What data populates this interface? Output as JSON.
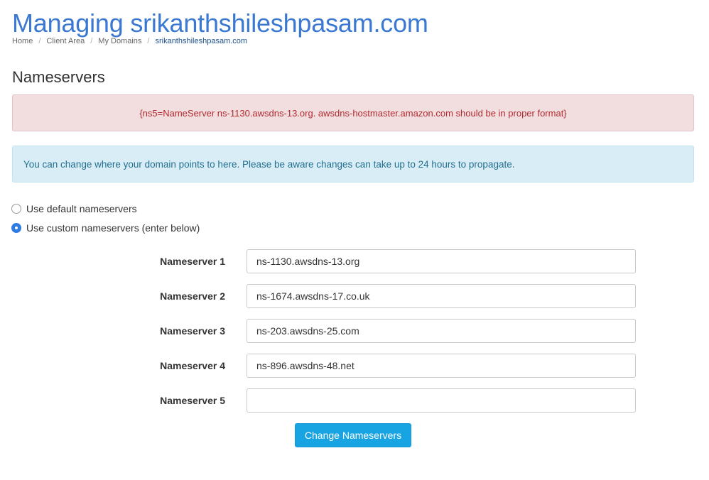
{
  "header": {
    "title": "Managing srikanthshileshpasam.com",
    "breadcrumb": [
      {
        "label": "Home"
      },
      {
        "label": "Client Area"
      },
      {
        "label": "My Domains"
      },
      {
        "label": "srikanthshileshpasam.com"
      }
    ],
    "breadcrumb_separator": "/"
  },
  "section": {
    "title": "Nameservers"
  },
  "alerts": {
    "error": "{ns5=NameServer ns-1130.awsdns-13.org. awsdns-hostmaster.amazon.com should be in proper format}",
    "info": "You can change where your domain points to here. Please be aware changes can take up to 24 hours to propagate."
  },
  "options": {
    "default_label": "Use default nameservers",
    "custom_label": "Use custom nameservers (enter below)",
    "selected": "custom"
  },
  "nameservers": [
    {
      "label": "Nameserver 1",
      "value": "ns-1130.awsdns-13.org"
    },
    {
      "label": "Nameserver 2",
      "value": "ns-1674.awsdns-17.co.uk"
    },
    {
      "label": "Nameserver 3",
      "value": "ns-203.awsdns-25.com"
    },
    {
      "label": "Nameserver 4",
      "value": "ns-896.awsdns-48.net"
    },
    {
      "label": "Nameserver 5",
      "value": ""
    }
  ],
  "submit": {
    "label": "Change Nameservers"
  },
  "colors": {
    "title": "#3a78d2",
    "error_bg": "#f2dede",
    "error_text": "#b12a32",
    "info_bg": "#d9edf7",
    "info_text": "#24708f",
    "button": "#18a3e2",
    "radio_checked": "#2f7ae5"
  }
}
